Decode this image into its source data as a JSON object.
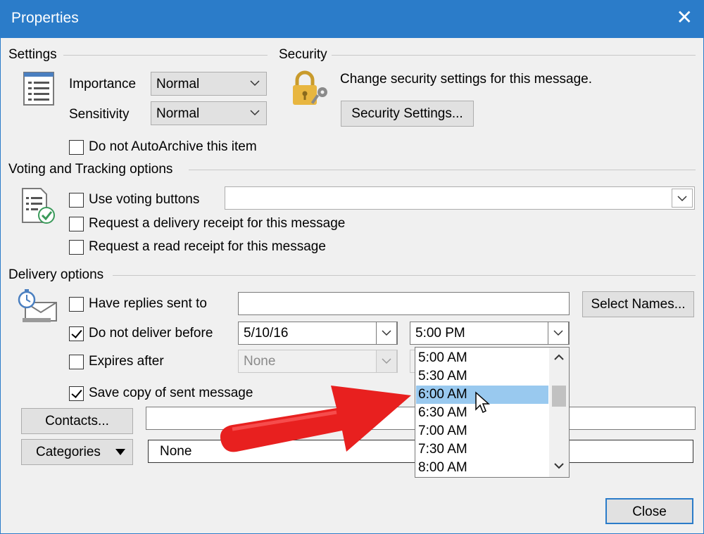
{
  "window": {
    "title": "Properties",
    "close_glyph": "✕"
  },
  "settings": {
    "heading": "Settings",
    "importance_label": "Importance",
    "importance_value": "Normal",
    "sensitivity_label": "Sensitivity",
    "sensitivity_value": "Normal",
    "autoarchive_label": "Do not AutoArchive this item",
    "autoarchive_checked": false
  },
  "security": {
    "heading": "Security",
    "description": "Change security settings for this message.",
    "button_label": "Security Settings..."
  },
  "voting": {
    "heading": "Voting and Tracking options",
    "use_voting_label": "Use voting buttons",
    "use_voting_value": "",
    "delivery_receipt_label": "Request a delivery receipt for this message",
    "read_receipt_label": "Request a read receipt for this message"
  },
  "delivery": {
    "heading": "Delivery options",
    "replies_label": "Have replies sent to",
    "replies_value": "",
    "select_names_label": "Select Names...",
    "deliver_before_label": "Do not deliver before",
    "deliver_before_checked": true,
    "deliver_date": "5/10/16",
    "deliver_time": "5:00 PM",
    "expires_label": "Expires after",
    "expires_value": "None",
    "save_copy_label": "Save copy of sent message",
    "save_copy_checked": true
  },
  "time_list": {
    "items": [
      "5:00 AM",
      "5:30 AM",
      "6:00 AM",
      "6:30 AM",
      "7:00 AM",
      "7:30 AM",
      "8:00 AM"
    ],
    "selected": "6:00 AM"
  },
  "contacts": {
    "button_label": "Contacts...",
    "value": ""
  },
  "categories": {
    "button_label": "Categories",
    "value": "None"
  },
  "footer": {
    "close_label": "Close"
  },
  "colors": {
    "titlebar": "#2b7cc9",
    "selection": "#99c9ef",
    "arrow": "#e8201f"
  }
}
